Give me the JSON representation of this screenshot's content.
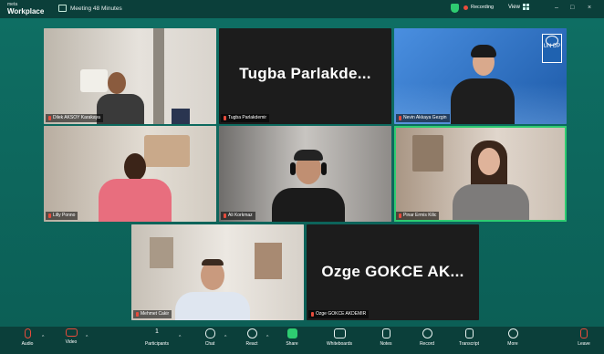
{
  "app": {
    "brand_small": "meta",
    "brand_name": "Workplace",
    "meeting_title": "Meeting 48 Minutes"
  },
  "topbar": {
    "recording": "Recording",
    "view_label": "View",
    "min": "–",
    "max": "□",
    "close": "×"
  },
  "tiles": [
    {
      "label": "Dilek AKSOY Karakaya",
      "kind": "video"
    },
    {
      "label": "Tugba Parlakdemir",
      "display_name": "Tugba  Parlakde...",
      "kind": "name"
    },
    {
      "label": "Nevin Akkaya Gezgin",
      "kind": "video"
    },
    {
      "label": "Lilly Ponno",
      "kind": "video"
    },
    {
      "label": "Ali Korkmaz",
      "kind": "video"
    },
    {
      "label": "Pinar Ermis Kilic",
      "kind": "video"
    },
    {
      "label": "Mehmet Cakir",
      "kind": "video"
    },
    {
      "label": "Ozge GOKCE AKDEMIR",
      "display_name": "Ozge GOKCE AK...",
      "kind": "name"
    }
  ],
  "logo": {
    "text": "UN DP"
  },
  "toolbar": {
    "audio": "Audio",
    "video": "Video",
    "participants": "Participants",
    "participants_count": "1",
    "chat": "Chat",
    "react": "React",
    "share": "Share",
    "whiteboards": "Whiteboards",
    "notes": "Notes",
    "record": "Record",
    "transcript": "Transcript",
    "more": "More",
    "leave": "Leave"
  },
  "colors": {
    "accent": "#2ecc71",
    "muted": "#e74c3c",
    "bg": "#0f4a44"
  }
}
